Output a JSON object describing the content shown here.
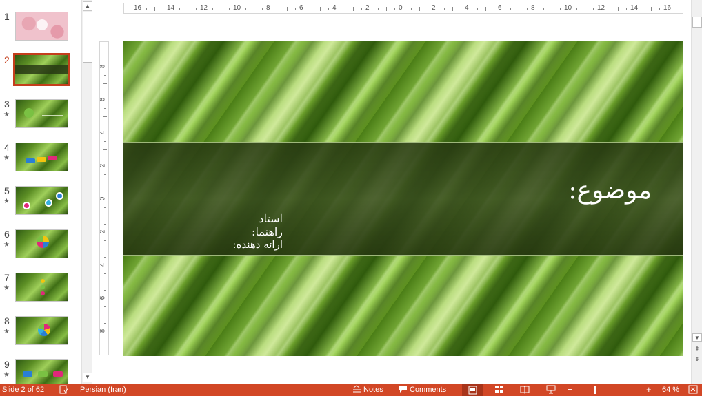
{
  "thumbnails": [
    {
      "num": "1",
      "star": "",
      "style": "pink"
    },
    {
      "num": "2",
      "star": "",
      "style": "title"
    },
    {
      "num": "3",
      "star": "★",
      "style": "content"
    },
    {
      "num": "4",
      "star": "★",
      "style": "content"
    },
    {
      "num": "5",
      "star": "★",
      "style": "content"
    },
    {
      "num": "6",
      "star": "★",
      "style": "content"
    },
    {
      "num": "7",
      "star": "★",
      "style": "content"
    },
    {
      "num": "8",
      "star": "★",
      "style": "content"
    },
    {
      "num": "9",
      "star": "★",
      "style": "content"
    }
  ],
  "ruler": {
    "horizontal": [
      "16",
      "14",
      "12",
      "10",
      "8",
      "6",
      "4",
      "2",
      "0",
      "2",
      "4",
      "6",
      "8",
      "10",
      "12",
      "14",
      "16"
    ],
    "vertical": [
      "8",
      "6",
      "4",
      "2",
      "0",
      "2",
      "4",
      "6",
      "8"
    ]
  },
  "slide": {
    "title": "موضوع:",
    "subtitle_1": "استاد راهنما:",
    "subtitle_2": "ارائه دهنده:"
  },
  "status_bar": {
    "slide_info": "Slide 2 of 62",
    "language": "Persian (Iran)",
    "notes": "Notes",
    "comments": "Comments",
    "zoom_minus": "−",
    "zoom_plus": "+",
    "zoom": "64 %"
  },
  "colors": {
    "accent": "#d24726",
    "active_thumb": "#c43e1c"
  },
  "icons": [
    "spell-check-icon",
    "notes-icon",
    "comments-icon",
    "normal-view-icon",
    "slide-sorter-icon",
    "reading-view-icon",
    "slideshow-icon",
    "fit-to-window-icon"
  ]
}
